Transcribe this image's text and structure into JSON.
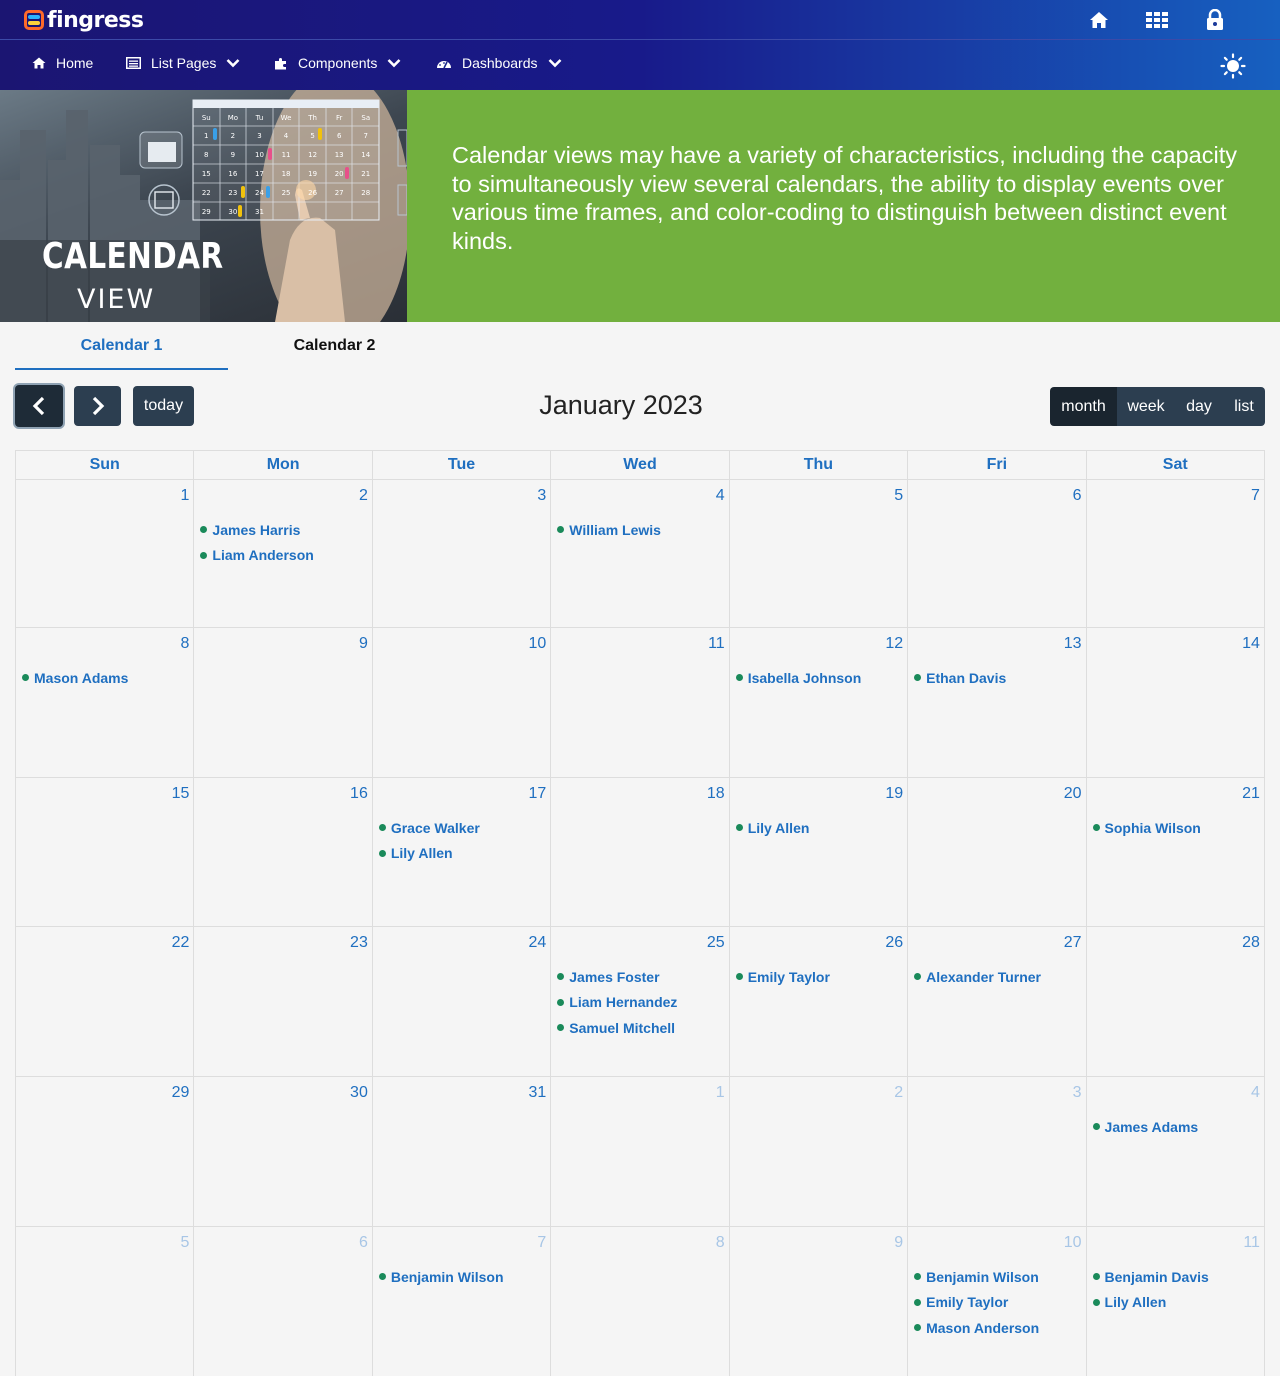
{
  "app": {
    "logo_text": "fingress",
    "colors": {
      "header_start": "#1b1572",
      "header_end": "#1760c0",
      "banner_green": "#72b03e",
      "accent": "#1f6fc0",
      "event_dot": "#1a8a5a",
      "button_dark": "#2c3e50"
    }
  },
  "top_icons": [
    "home-icon",
    "apps-grid-icon",
    "lock-icon"
  ],
  "nav": {
    "items": [
      {
        "label": "Home",
        "icon": "home-icon",
        "dropdown": false
      },
      {
        "label": "List Pages",
        "icon": "list-icon",
        "dropdown": true
      },
      {
        "label": "Components",
        "icon": "puzzle-icon",
        "dropdown": true
      },
      {
        "label": "Dashboards",
        "icon": "dashboard-icon",
        "dropdown": true
      }
    ],
    "theme_icon": "sun-icon"
  },
  "banner": {
    "image_title_1": "CALENDAR",
    "image_title_2": "VIEW",
    "mini_calendar": {
      "weekdays": [
        "Su",
        "Mo",
        "Tu",
        "We",
        "Th",
        "Fr",
        "Sa"
      ],
      "rows": [
        [
          "1",
          "2",
          "3",
          "4",
          "5",
          "6",
          "7"
        ],
        [
          "8",
          "9",
          "10",
          "11",
          "12",
          "13",
          "14"
        ],
        [
          "15",
          "16",
          "17",
          "18",
          "19",
          "20",
          "21"
        ],
        [
          "22",
          "23",
          "24",
          "25",
          "26",
          "27",
          "28"
        ],
        [
          "29",
          "30",
          "31",
          "",
          "",
          "",
          ""
        ]
      ]
    },
    "description": "Calendar views may have a variety of characteristics, including the capacity to simultaneously view several calendars, the ability to display events over various time frames, and color-coding to distinguish between distinct event kinds."
  },
  "tabs": [
    {
      "label": "Calendar 1",
      "active": true
    },
    {
      "label": "Calendar 2",
      "active": false
    }
  ],
  "toolbar": {
    "prev_icon": "chevron-left-icon",
    "next_icon": "chevron-right-icon",
    "today_label": "today",
    "title": "January 2023",
    "views": [
      {
        "label": "month",
        "active": true
      },
      {
        "label": "week",
        "active": false
      },
      {
        "label": "day",
        "active": false
      },
      {
        "label": "list",
        "active": false
      }
    ]
  },
  "calendar": {
    "weekdays": [
      "Sun",
      "Mon",
      "Tue",
      "Wed",
      "Thu",
      "Fri",
      "Sat"
    ],
    "weeks": [
      [
        {
          "day": "1",
          "other": false,
          "events": []
        },
        {
          "day": "2",
          "other": false,
          "events": [
            "James Harris",
            "Liam Anderson"
          ]
        },
        {
          "day": "3",
          "other": false,
          "events": []
        },
        {
          "day": "4",
          "other": false,
          "events": [
            "William Lewis"
          ]
        },
        {
          "day": "5",
          "other": false,
          "events": []
        },
        {
          "day": "6",
          "other": false,
          "events": []
        },
        {
          "day": "7",
          "other": false,
          "events": []
        }
      ],
      [
        {
          "day": "8",
          "other": false,
          "events": [
            "Mason Adams"
          ]
        },
        {
          "day": "9",
          "other": false,
          "events": []
        },
        {
          "day": "10",
          "other": false,
          "events": []
        },
        {
          "day": "11",
          "other": false,
          "events": []
        },
        {
          "day": "12",
          "other": false,
          "events": [
            "Isabella Johnson"
          ]
        },
        {
          "day": "13",
          "other": false,
          "events": [
            "Ethan Davis"
          ]
        },
        {
          "day": "14",
          "other": false,
          "events": []
        }
      ],
      [
        {
          "day": "15",
          "other": false,
          "events": []
        },
        {
          "day": "16",
          "other": false,
          "events": []
        },
        {
          "day": "17",
          "other": false,
          "events": [
            "Grace Walker",
            "Lily Allen"
          ]
        },
        {
          "day": "18",
          "other": false,
          "events": []
        },
        {
          "day": "19",
          "other": false,
          "events": [
            "Lily Allen"
          ]
        },
        {
          "day": "20",
          "other": false,
          "events": []
        },
        {
          "day": "21",
          "other": false,
          "events": [
            "Sophia Wilson"
          ]
        }
      ],
      [
        {
          "day": "22",
          "other": false,
          "events": []
        },
        {
          "day": "23",
          "other": false,
          "events": []
        },
        {
          "day": "24",
          "other": false,
          "events": []
        },
        {
          "day": "25",
          "other": false,
          "events": [
            "James Foster",
            "Liam Hernandez",
            "Samuel Mitchell"
          ]
        },
        {
          "day": "26",
          "other": false,
          "events": [
            "Emily Taylor"
          ]
        },
        {
          "day": "27",
          "other": false,
          "events": [
            "Alexander Turner"
          ]
        },
        {
          "day": "28",
          "other": false,
          "events": []
        }
      ],
      [
        {
          "day": "29",
          "other": false,
          "events": []
        },
        {
          "day": "30",
          "other": false,
          "events": []
        },
        {
          "day": "31",
          "other": false,
          "events": []
        },
        {
          "day": "1",
          "other": true,
          "events": []
        },
        {
          "day": "2",
          "other": true,
          "events": []
        },
        {
          "day": "3",
          "other": true,
          "events": []
        },
        {
          "day": "4",
          "other": true,
          "events": [
            "James Adams"
          ]
        }
      ],
      [
        {
          "day": "5",
          "other": true,
          "events": []
        },
        {
          "day": "6",
          "other": true,
          "events": []
        },
        {
          "day": "7",
          "other": true,
          "events": [
            "Benjamin Wilson"
          ]
        },
        {
          "day": "8",
          "other": true,
          "events": []
        },
        {
          "day": "9",
          "other": true,
          "events": []
        },
        {
          "day": "10",
          "other": true,
          "events": [
            "Benjamin Wilson",
            "Emily Taylor",
            "Mason Anderson"
          ]
        },
        {
          "day": "11",
          "other": true,
          "events": [
            "Benjamin Davis",
            "Lily Allen"
          ]
        }
      ]
    ]
  }
}
